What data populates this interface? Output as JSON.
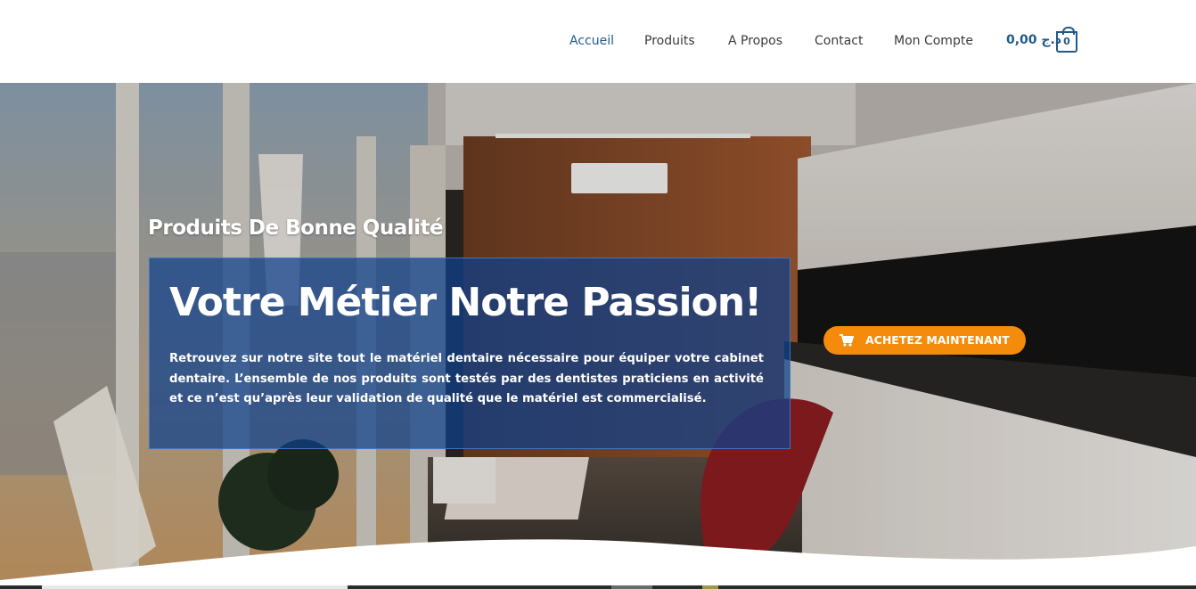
{
  "nav": {
    "items": [
      {
        "label": "Accueil",
        "active": true
      },
      {
        "label": "Produits",
        "active": false
      },
      {
        "label": "A Propos",
        "active": false
      },
      {
        "label": "Contact",
        "active": false
      },
      {
        "label": "Mon Compte",
        "active": false
      }
    ],
    "cart": {
      "amount": "0,00 د.ج",
      "count": "0",
      "icon": "shopping-bag-icon"
    }
  },
  "hero": {
    "subtitle": "Produits De Bonne Qualité",
    "headline": "Votre Métier Notre Passion!",
    "body": "Retrouvez sur notre site tout le matériel dentaire nécessaire pour équiper votre cabinet dentaire. L’ensemble de nos produits sont testés par des dentistes praticiens en activité et ce n’est qu’après leur validation de qualité que le matériel est commercialisé.",
    "cta": {
      "label": "ACHETEZ MAINTENANT",
      "icon": "cart-icon"
    }
  },
  "colors": {
    "accent_blue": "#1f5a8a",
    "cta_orange": "#f48b0a",
    "panel_blue": "#0e408c"
  }
}
